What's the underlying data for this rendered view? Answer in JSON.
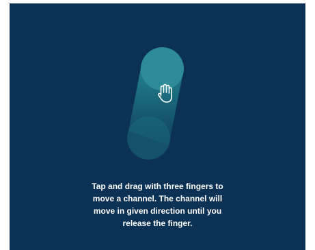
{
  "screen": {
    "background_color": "#0b3154",
    "accent_color": "#2f8f9a"
  },
  "gesture": {
    "icon": "hand-icon",
    "action": "three-finger-drag"
  },
  "instruction": {
    "lines": [
      "Tap and drag with three fingers to",
      "move a channel. The channel will",
      "move in given direction until you",
      "release the finger."
    ]
  }
}
